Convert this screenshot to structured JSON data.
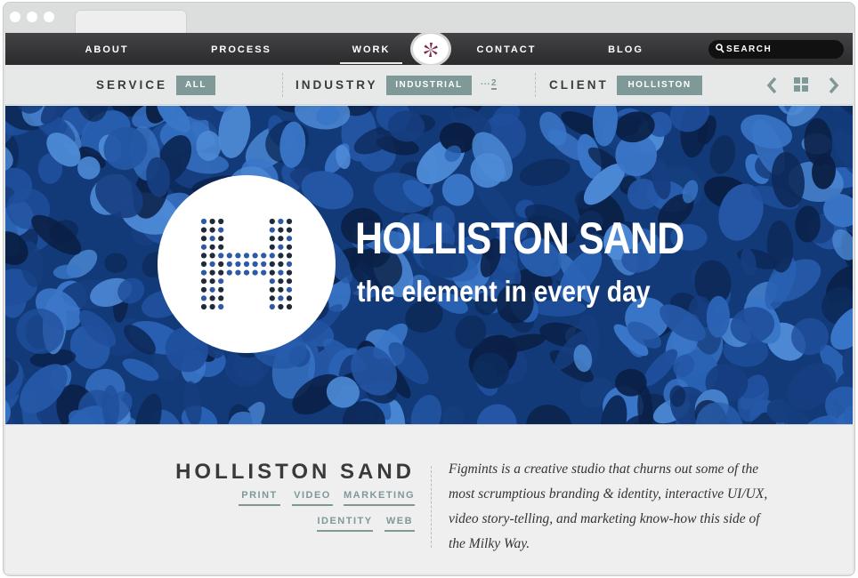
{
  "nav": {
    "items": [
      {
        "label": "ABOUT"
      },
      {
        "label": "PROCESS"
      },
      {
        "label": "WORK",
        "active": true
      },
      {
        "label": "CONTACT"
      },
      {
        "label": "BLOG"
      }
    ],
    "search_label": "SEARCH"
  },
  "filters": {
    "service_label": "SERVICE",
    "service_value": "ALL",
    "industry_label": "INDUSTRY",
    "industry_value": "INDUSTRIAL",
    "industry_more_dots": "...",
    "industry_more_count": "2",
    "client_label": "CLIENT",
    "client_value": "HOLLISTON"
  },
  "hero": {
    "title": "HOLLISTON SAND",
    "tagline": "the element in every day"
  },
  "project": {
    "title": "HOLLISTON SAND",
    "tags": [
      "PRINT",
      "VIDEO",
      "MARKETING",
      "IDENTITY",
      "WEB"
    ],
    "description": "Figmints is a creative studio that churns out some of the most scrumptious branding & identity, interactive UI/UX, video story-telling, and marketing know-how this side of the Milky Way."
  },
  "colors": {
    "nav_bg": "#2f2e30",
    "accent": "#7f9898",
    "hero_blue": "#1d4c98",
    "logo_dark": "#1f2a3a",
    "logo_blue": "#2c5aa6"
  },
  "icons": {
    "logo": "pinwheel-icon",
    "search": "search-icon",
    "prev": "chevron-left-icon",
    "grid": "grid-icon",
    "next": "chevron-right-icon"
  }
}
